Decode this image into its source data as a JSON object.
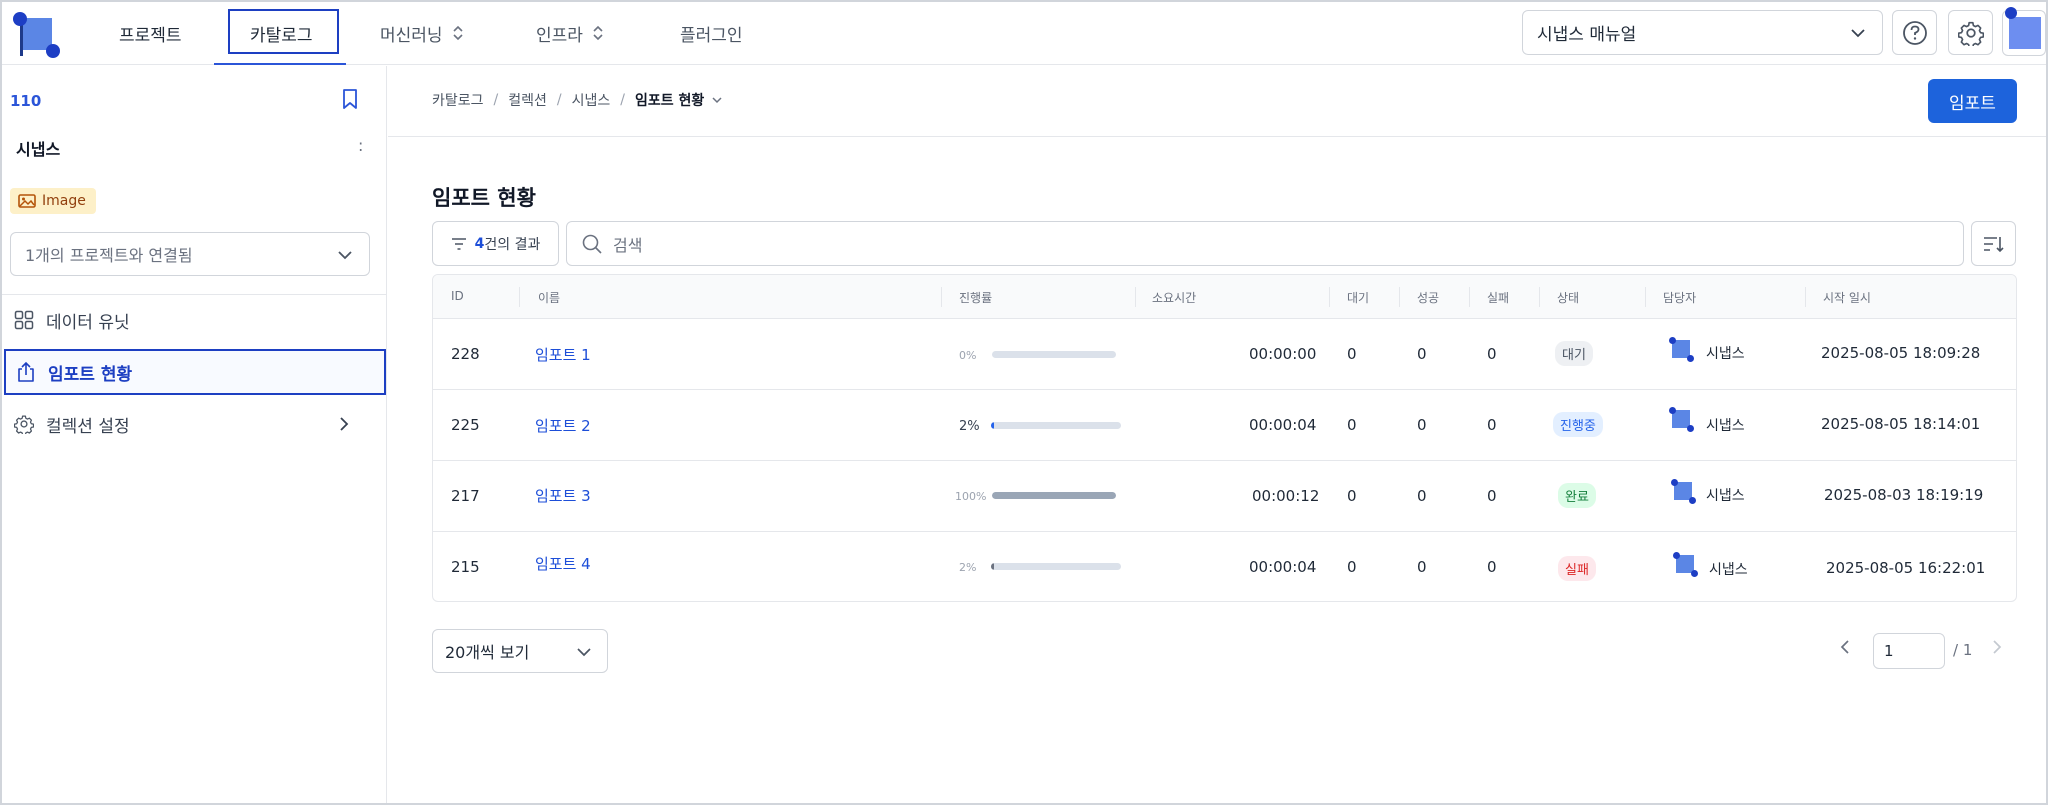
{
  "nav": {
    "items": [
      {
        "label": "프로젝트",
        "has_menu": false
      },
      {
        "label": "카탈로그",
        "has_menu": false
      },
      {
        "label": "머신러닝",
        "has_menu": true
      },
      {
        "label": "인프라",
        "has_menu": true
      },
      {
        "label": "플러그인",
        "has_menu": false
      }
    ],
    "active_item": "카탈로그",
    "manual_select": "시냅스 매뉴얼"
  },
  "sidebar": {
    "id": "110",
    "name": "시냅스",
    "more": ":",
    "tag": "Image",
    "project_select": "1개의 프로젝트와 연결됨",
    "items": [
      {
        "label": "데이터 유닛",
        "icon": "grid-icon"
      },
      {
        "label": "임포트 현황",
        "icon": "upload-icon",
        "active": true
      },
      {
        "label": "컬렉션 설정",
        "icon": "gear-icon"
      }
    ]
  },
  "breadcrumb": [
    "카탈로그",
    "컬렉션",
    "시냅스",
    "임포트 현황"
  ],
  "import_button": "임포트",
  "page_title": "임포트 현황",
  "filter": {
    "count": "4",
    "suffix": "건의 결과"
  },
  "search": {
    "placeholder": "검색"
  },
  "table": {
    "headers": [
      "ID",
      "이름",
      "진행률",
      "소요시간",
      "대기",
      "성공",
      "실패",
      "상태",
      "담당자",
      "시작 일시"
    ],
    "rows": [
      {
        "id": "228",
        "name": "임포트 1",
        "progress_label": "0%",
        "progress": 0,
        "duration": "00:00:00",
        "wait": "0",
        "success": "0",
        "fail": "0",
        "status": "대기",
        "status_kind": "wait",
        "owner": "시냅스",
        "started": "2025-08-05 18:09:28"
      },
      {
        "id": "225",
        "name": "임포트 2",
        "progress_label": "2%",
        "progress": 2,
        "duration": "00:00:04",
        "wait": "0",
        "success": "0",
        "fail": "0",
        "status": "진행중",
        "status_kind": "prog",
        "owner": "시냅스",
        "started": "2025-08-05 18:14:01"
      },
      {
        "id": "217",
        "name": "임포트 3",
        "progress_label": "100%",
        "progress": 100,
        "duration": "00:00:12",
        "wait": "0",
        "success": "0",
        "fail": "0",
        "status": "완료",
        "status_kind": "done",
        "owner": "시냅스",
        "started": "2025-08-03 18:19:19"
      },
      {
        "id": "215",
        "name": "임포트 4",
        "progress_label": "2%",
        "progress": 2,
        "duration": "00:00:04",
        "wait": "0",
        "success": "0",
        "fail": "0",
        "status": "실패",
        "status_kind": "fail",
        "owner": "시냅스",
        "started": "2025-08-05 16:22:01"
      }
    ]
  },
  "pagination": {
    "page_size": "20개씩 보기",
    "current_page": "1",
    "total": "/ 1"
  },
  "colors": {
    "accent": "#1d63dc",
    "link": "#1d4ed8",
    "progress_active": "#2563eb",
    "progress_done": "#9aa6b6"
  }
}
